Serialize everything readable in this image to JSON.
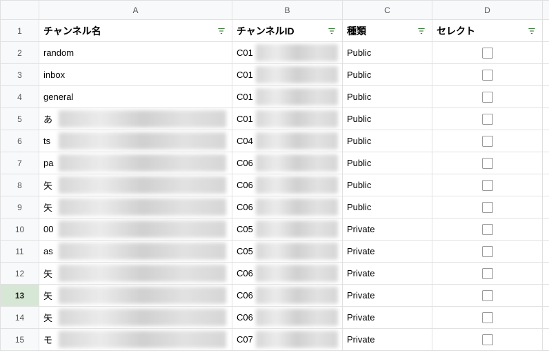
{
  "columns": {
    "corner": "",
    "A": "A",
    "B": "B",
    "C": "C",
    "D": "D"
  },
  "headers": {
    "A": "チャンネル名",
    "B": "チャンネルID",
    "C": "種類",
    "D": "セレクト"
  },
  "selected_row": 13,
  "rows": [
    {
      "n": 1
    },
    {
      "n": 2,
      "a_vis": "random",
      "a_blur": false,
      "b_vis": "C01",
      "c": "Public"
    },
    {
      "n": 3,
      "a_vis": "inbox",
      "a_blur": false,
      "b_vis": "C01",
      "c": "Public"
    },
    {
      "n": 4,
      "a_vis": "general",
      "a_blur": false,
      "b_vis": "C01",
      "c": "Public"
    },
    {
      "n": 5,
      "a_vis": "あ",
      "a_blur": true,
      "b_vis": "C01",
      "c": "Public"
    },
    {
      "n": 6,
      "a_vis": "ts",
      "a_blur": true,
      "b_vis": "C04",
      "c": "Public"
    },
    {
      "n": 7,
      "a_vis": "pa",
      "a_blur": true,
      "b_vis": "C06",
      "c": "Public"
    },
    {
      "n": 8,
      "a_vis": "矢",
      "a_blur": true,
      "b_vis": "C06",
      "c": "Public"
    },
    {
      "n": 9,
      "a_vis": "矢",
      "a_blur": true,
      "b_vis": "C06",
      "c": "Public"
    },
    {
      "n": 10,
      "a_vis": "00",
      "a_blur": true,
      "b_vis": "C05",
      "c": "Private"
    },
    {
      "n": 11,
      "a_vis": "as",
      "a_blur": true,
      "b_vis": "C05",
      "c": "Private"
    },
    {
      "n": 12,
      "a_vis": "矢",
      "a_blur": true,
      "b_vis": "C06",
      "c": "Private"
    },
    {
      "n": 13,
      "a_vis": "矢",
      "a_blur": true,
      "b_vis": "C06",
      "c": "Private"
    },
    {
      "n": 14,
      "a_vis": "矢",
      "a_blur": true,
      "b_vis": "C06",
      "c": "Private"
    },
    {
      "n": 15,
      "a_vis": "モ",
      "a_blur": true,
      "b_vis": "C07",
      "c": "Private"
    }
  ]
}
